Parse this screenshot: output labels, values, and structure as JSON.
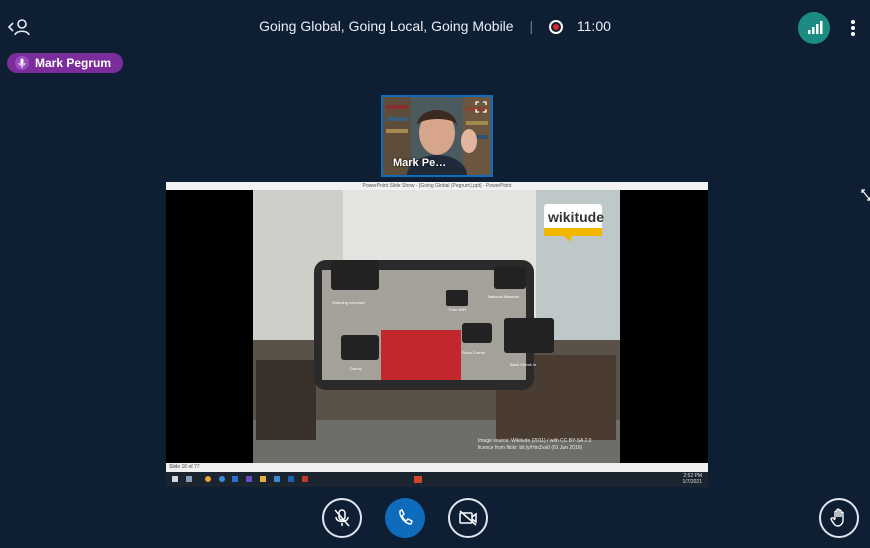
{
  "meeting": {
    "title": "Going Global, Going Local, Going Mobile",
    "separator": "|",
    "recording_time": "11:00"
  },
  "talking_indicator": {
    "name": "Mark Pegrum"
  },
  "webcam": {
    "name": "Mark Pe…"
  },
  "presentation": {
    "window_title": "PowerPoint Slide Show - [Going Global (Pegrum).ppt] - PowerPoint",
    "brand_label": "wikitude",
    "poi_labels": [
      "Stunning overview",
      "National Museum",
      "Free WiFi",
      "Pizza Corner",
      "Bank Check In",
      "Dandy"
    ],
    "caption_line1": "Image source: Wikitude (2011) / with CC BY-SA 2.0",
    "caption_line2": "licence from flickr: bit.ly/HmZva0 (01 Jun 2016)",
    "status_left": "Slide 16 of 77",
    "clock_time": "2:52 PM",
    "clock_date": "1/7/2021"
  },
  "colors": {
    "background": "#0f1f33",
    "talker_badge": "#7b2d9c",
    "call_button": "#0f6cbd",
    "connection": "#1c8c82",
    "record": "#e0242b"
  },
  "icons": {
    "users": "user-list-icon",
    "connection": "signal-bars-icon",
    "more": "vertical-dots-icon",
    "mic": "mic-muted-icon",
    "leave": "phone-icon",
    "camera": "camera-off-icon",
    "raise_hand": "hand-icon",
    "fullscreen": "expand-icon"
  }
}
